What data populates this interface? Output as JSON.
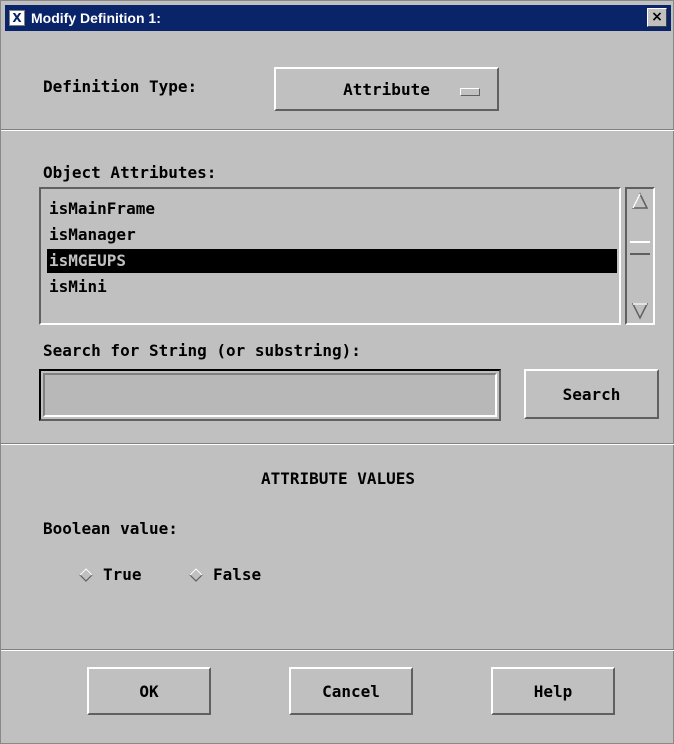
{
  "window": {
    "title": "Modify Definition 1:",
    "app_icon_glyph": "X",
    "close_glyph": "×"
  },
  "definition_type": {
    "label": "Definition Type:",
    "value": "Attribute"
  },
  "object_attributes": {
    "label": "Object Attributes:",
    "items": [
      "isMainFrame",
      "isManager",
      "isMGEUPS",
      "isMini"
    ],
    "selected_index": 2
  },
  "search": {
    "label": "Search for String (or substring):",
    "value": "",
    "button_label": "Search"
  },
  "attribute_values": {
    "heading": "ATTRIBUTE VALUES",
    "boolean_label": "Boolean value:",
    "options": [
      "True",
      "False"
    ]
  },
  "buttons": {
    "ok": "OK",
    "cancel": "Cancel",
    "help": "Help"
  },
  "colors": {
    "title_bar": "#0a246a",
    "background": "#c0c0c0",
    "selection": "#000000"
  },
  "icons": {
    "app": "x-app-icon",
    "close": "close-icon",
    "scroll_up": "arrow-up-icon",
    "scroll_down": "arrow-down-icon",
    "radio": "diamond-radio-icon"
  }
}
